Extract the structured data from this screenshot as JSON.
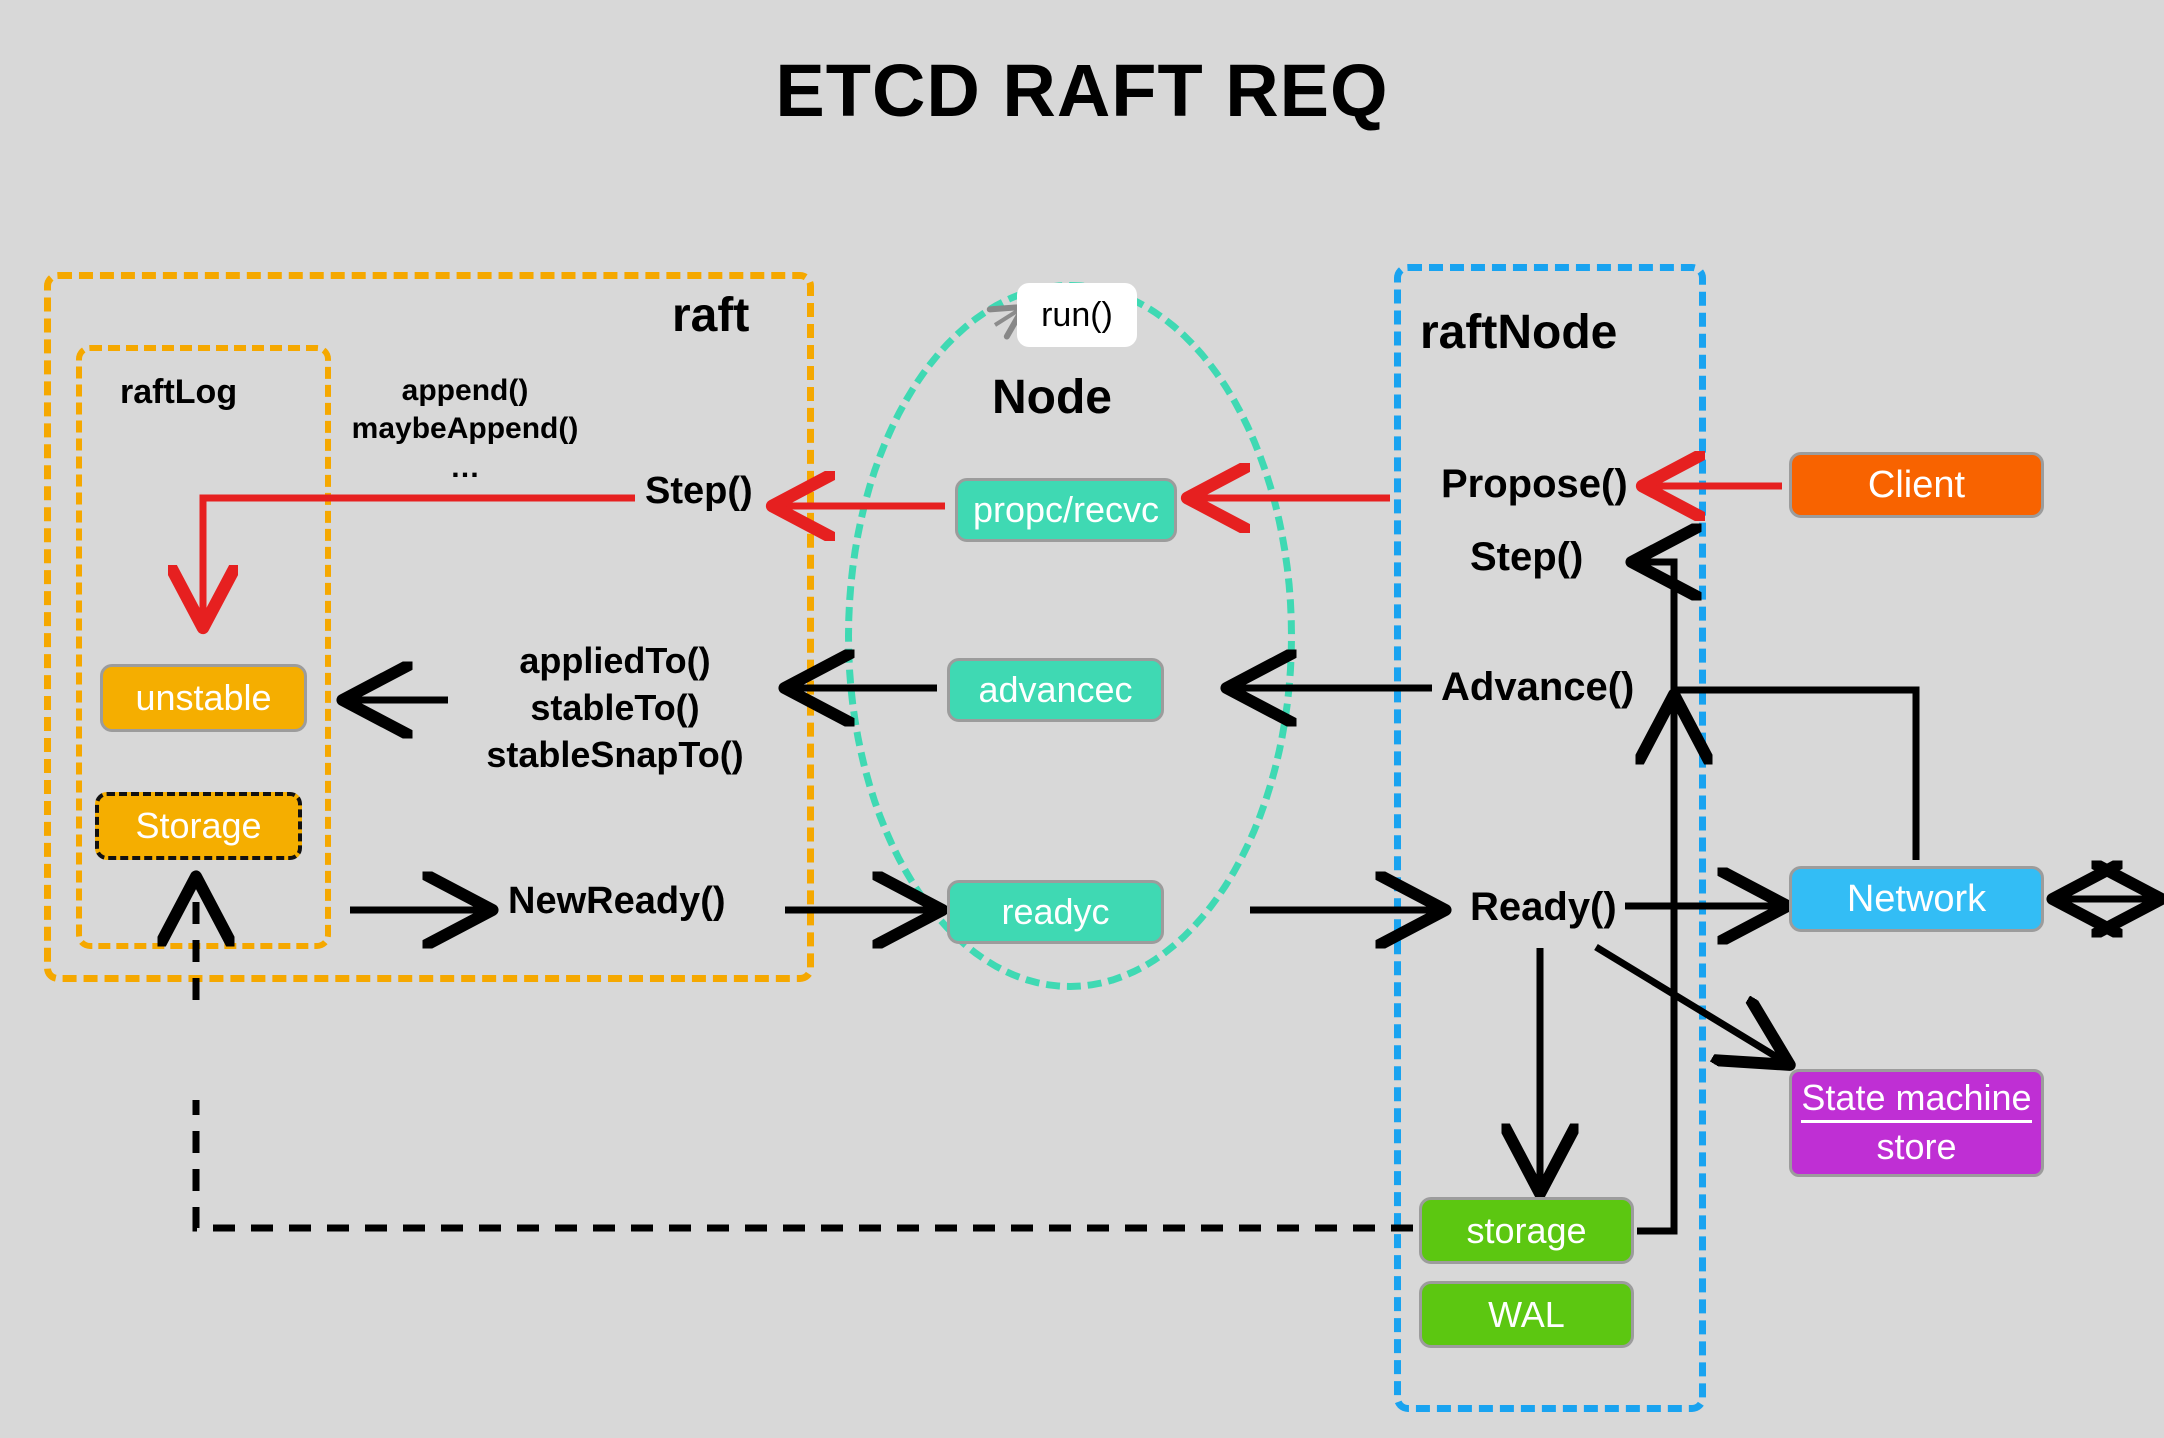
{
  "title": "ETCD RAFT REQ",
  "groups": {
    "raft": {
      "label": "raft"
    },
    "raftlog": {
      "label": "raftLog"
    },
    "raftnode": {
      "label": "raftNode"
    },
    "node": {
      "label": "Node",
      "run_label": "run()"
    }
  },
  "node_boxes": {
    "propc": "propc/recvc",
    "advancec": "advancec",
    "readyc": "readyc"
  },
  "raftlog_boxes": {
    "unstable": "unstable",
    "storage": "Storage"
  },
  "raftnode_boxes": {
    "storage": "storage",
    "wal": "WAL"
  },
  "entities": {
    "client": "Client",
    "network": "Network",
    "state_machine_line1": "State machine",
    "state_machine_line2": "store"
  },
  "labels": {
    "append_block": "append()\nmaybeAppend()\n…",
    "step_left": "Step()",
    "applied_block": "appliedTo()\nstableTo()\nstableSnapTo()",
    "new_ready": "NewReady()",
    "propose": "Propose()",
    "step_right": "Step()",
    "advance": "Advance()",
    "ready": "Ready()"
  },
  "colors": {
    "background": "#d8d8d8",
    "raft_group_border": "#f5a800",
    "raftnode_group_border": "#19a3f0",
    "node_ellipse_border": "#3fd9b3",
    "node_box_fill": "#3fd9b3",
    "raftlog_box_fill": "#f5ae00",
    "green_box_fill": "#5cc711",
    "client_fill": "#f86300",
    "network_fill": "#33bdf5",
    "state_machine_fill": "#bf2fd4",
    "red_arrow": "#e62020",
    "black_arrow": "#000000"
  }
}
